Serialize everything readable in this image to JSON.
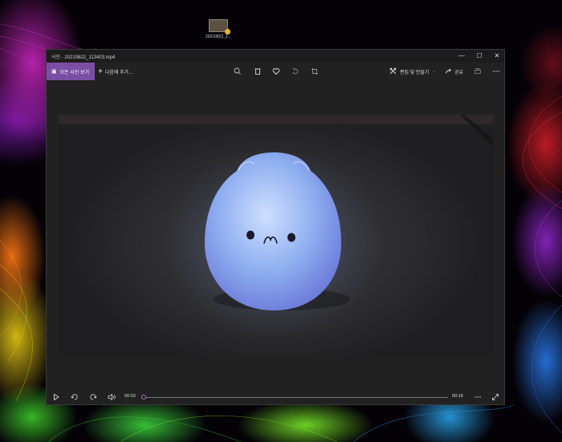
{
  "desktop": {
    "file_label": "20210622_1..."
  },
  "window": {
    "app_name": "사진",
    "file_name": "20210622_113403.mp4",
    "controls": {
      "minimize": "—",
      "maximize": "☐",
      "close": "✕"
    }
  },
  "toolbar": {
    "see_all_label": "모든 사진 보기",
    "add_to_label": "다음에 추가...",
    "edit_create_label": "편집 및 만들기",
    "share_label": "공유",
    "icons": [
      "zoom-icon",
      "delete-icon",
      "heart-icon",
      "rotate-icon",
      "crop-icon",
      "print-icon",
      "more-icon"
    ]
  },
  "player": {
    "current_time": "00:03",
    "total_time": "00:16",
    "progress": 0.0
  },
  "colors": {
    "accent": "#7a4fa3",
    "window_bg": "#212121",
    "titlebar_bg": "#1c1c1c"
  }
}
